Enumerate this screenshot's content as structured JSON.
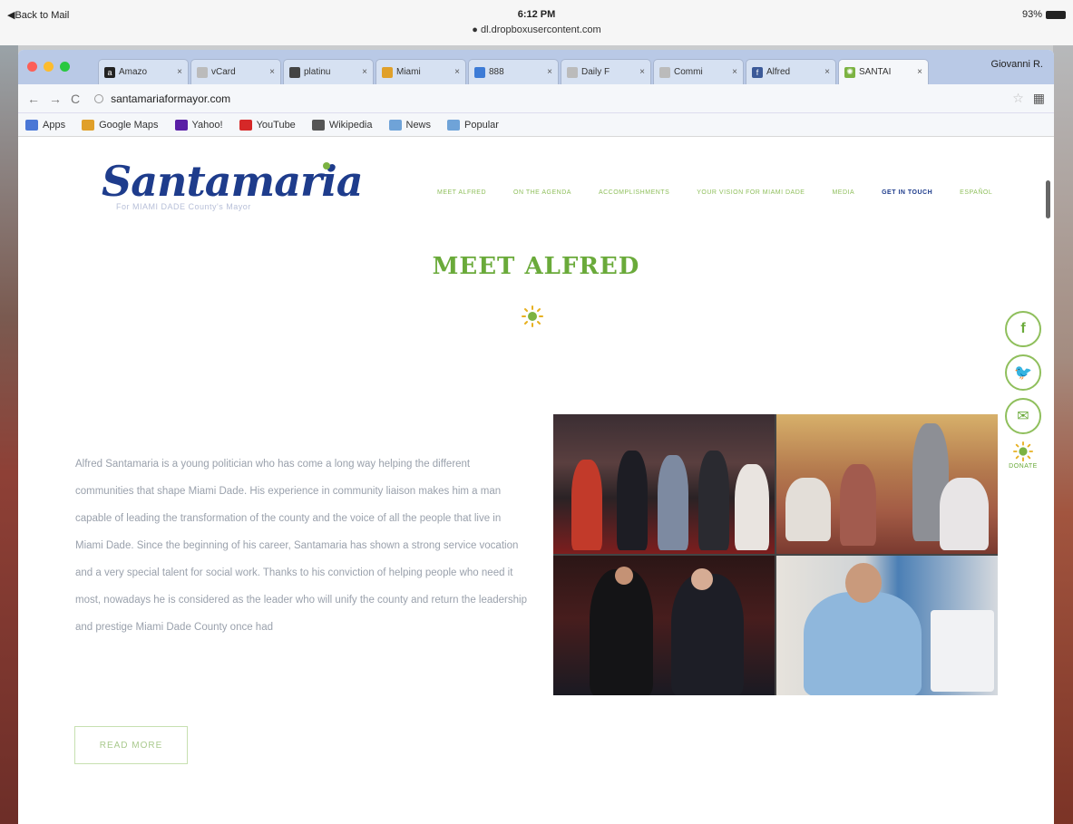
{
  "status_bar": {
    "back_label": "◀Back to Mail",
    "time": "6:12 PM",
    "domain": "dl.dropboxusercontent.com",
    "battery": "93%"
  },
  "browser": {
    "tabs": [
      {
        "label": "Amazo",
        "favicon": "a",
        "color": "#222"
      },
      {
        "label": "vCard",
        "favicon": "",
        "color": "#bbb"
      },
      {
        "label": "platinu",
        "favicon": "",
        "color": "#444"
      },
      {
        "label": "Miami",
        "favicon": "",
        "color": "#e0a02a"
      },
      {
        "label": "888",
        "favicon": "",
        "color": "#3d7bd6"
      },
      {
        "label": "Daily F",
        "favicon": "",
        "color": "#bbb"
      },
      {
        "label": "Commi",
        "favicon": "",
        "color": "#bbb"
      },
      {
        "label": "Alfred",
        "favicon": "f",
        "color": "#3b5998"
      },
      {
        "label": "SANTAI",
        "favicon": "✺",
        "color": "#7cb342"
      }
    ],
    "profile": "Giovanni R.",
    "url": "santamariaformayor.com",
    "bookmarks": [
      {
        "label": "Apps",
        "icon": "apps-icon",
        "color": "#4a77d6"
      },
      {
        "label": "Google Maps",
        "icon": "google-maps-icon",
        "color": "#e0a02a"
      },
      {
        "label": "Yahoo!",
        "icon": "yahoo-icon",
        "color": "#5a1fa6"
      },
      {
        "label": "YouTube",
        "icon": "youtube-icon",
        "color": "#d62828"
      },
      {
        "label": "Wikipedia",
        "icon": "wikipedia-icon",
        "color": "#555"
      },
      {
        "label": "News",
        "icon": "folder-icon",
        "color": "#6fa3d8"
      },
      {
        "label": "Popular",
        "icon": "folder-icon",
        "color": "#6fa3d8"
      }
    ]
  },
  "site": {
    "logo": "Santamaria",
    "logo_tagline": "For MIAMI DADE County's Mayor",
    "nav": [
      {
        "label": "Meet Alfred"
      },
      {
        "label": "On the Agenda"
      },
      {
        "label": "Accomplishments"
      },
      {
        "label": "Your Vision for Miami Dade"
      },
      {
        "label": "Media"
      },
      {
        "label": "Get in Touch",
        "active": true
      },
      {
        "label": "Español"
      }
    ],
    "heading": "MEET ALFRED",
    "bio": "Alfred Santamaria is a young politician who has come a long way helping the different communities that shape Miami Dade. His experience in community liaison makes him a man capable of leading the transformation of the county and the voice of all the people that live in Miami Dade. Since the beginning of his career, Santamaria has shown a strong service vocation and a very special talent for social work. Thanks to his conviction of helping people who need it most, nowadays he is considered as the leader who will unify the county and return the leadership and prestige Miami Dade County once had",
    "read_more": "READ MORE",
    "donate": "DONATE",
    "accent": "#6aaa3a",
    "brand_blue": "#1e3c8c"
  }
}
